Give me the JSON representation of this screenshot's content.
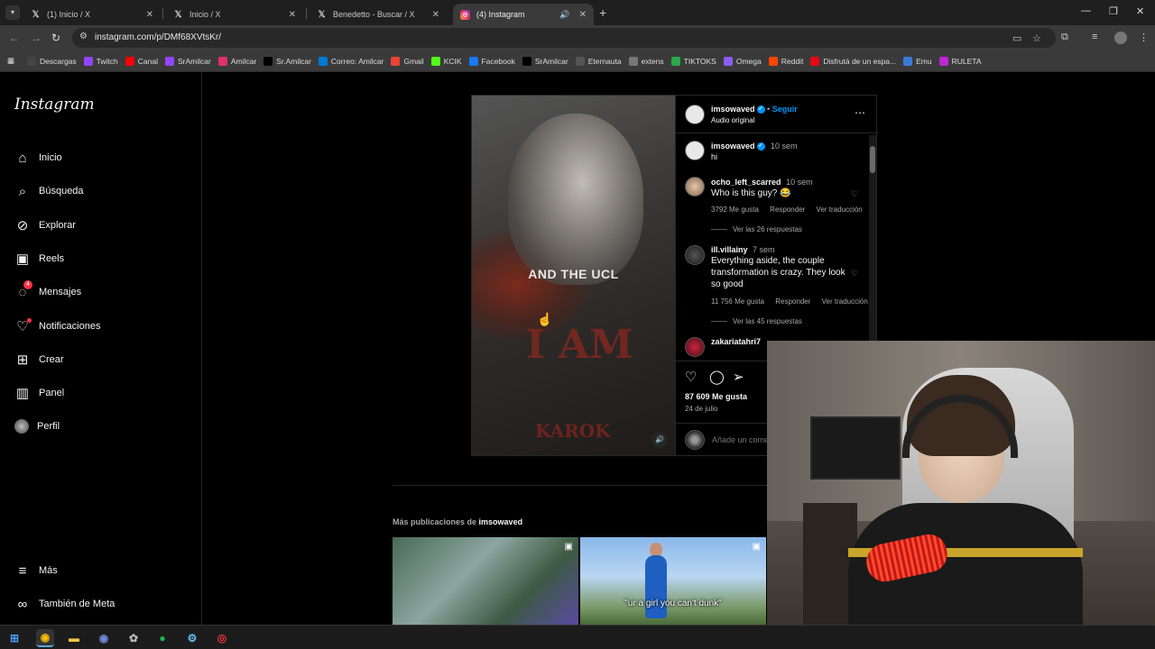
{
  "browser": {
    "tabs": [
      {
        "title": "(1) Inicio / X",
        "icon": "x-logo-icon",
        "active": false
      },
      {
        "title": "Inicio / X",
        "icon": "x-logo-icon",
        "active": false
      },
      {
        "title": "Benedetto - Buscar / X",
        "icon": "x-logo-icon",
        "active": false
      },
      {
        "title": "(4) Instagram",
        "icon": "instagram-icon",
        "active": true
      }
    ],
    "url": "instagram.com/p/DMf68XVtsKr/",
    "bookmarks": [
      {
        "label": "Descargas",
        "color": "#444444"
      },
      {
        "label": "Twitch",
        "color": "#9146ff"
      },
      {
        "label": "Canal",
        "color": "#ff0000"
      },
      {
        "label": "SrAmilcar",
        "color": "#9146ff"
      },
      {
        "label": "Amilcar",
        "color": "#e1306c"
      },
      {
        "label": "Sr.Amilcar",
        "color": "#000000"
      },
      {
        "label": "Correo: Amilcar",
        "color": "#0078d4"
      },
      {
        "label": "Gmail",
        "color": "#ea4335"
      },
      {
        "label": "KCIK",
        "color": "#53fc18"
      },
      {
        "label": "Facebook",
        "color": "#1877f2"
      },
      {
        "label": "SrAmilcar",
        "color": "#000000"
      },
      {
        "label": "Eternauta",
        "color": "#555555"
      },
      {
        "label": "extens",
        "color": "#777777"
      },
      {
        "label": "TIKTOKS",
        "color": "#2aa84a"
      },
      {
        "label": "Omega",
        "color": "#8a5cf6"
      },
      {
        "label": "Reddit",
        "color": "#ff4500"
      },
      {
        "label": "Disfrutá de un espa...",
        "color": "#e50914"
      },
      {
        "label": "Emu",
        "color": "#3a7bd5"
      },
      {
        "label": "RULETA",
        "color": "#c026d3"
      }
    ]
  },
  "instagram": {
    "logo": "Instagram",
    "nav": [
      {
        "label": "Inicio",
        "icon": "home-icon"
      },
      {
        "label": "Búsqueda",
        "icon": "search-icon"
      },
      {
        "label": "Explorar",
        "icon": "compass-icon"
      },
      {
        "label": "Reels",
        "icon": "reels-icon"
      },
      {
        "label": "Mensajes",
        "icon": "messenger-icon",
        "badge": "4"
      },
      {
        "label": "Notificaciones",
        "icon": "heart-icon"
      },
      {
        "label": "Crear",
        "icon": "plus-square-icon"
      },
      {
        "label": "Panel",
        "icon": "chart-icon"
      },
      {
        "label": "Perfil",
        "icon": "avatar-icon"
      }
    ],
    "nav_bottom": [
      {
        "label": "Más",
        "icon": "menu-icon"
      },
      {
        "label": "También de Meta",
        "icon": "meta-icon"
      }
    ],
    "post": {
      "media_caption": "AND THE UCL",
      "media_bg_text": "I AM",
      "media_bg_text2": "KAROK",
      "author": "imsowaved",
      "follow": "Seguir",
      "audio": "Audio original",
      "caption_user": "imsowaved",
      "caption_time": "10 sem",
      "caption_text": "hi",
      "comments": [
        {
          "user": "ocho_left_scarred",
          "time": "10 sem",
          "text": "Who is this guy? 😂",
          "likes": "3792 Me gusta",
          "reply": "Responder",
          "translate": "Ver traducción",
          "replies": "Ver las 26 respuestas"
        },
        {
          "user": "ill.villainy",
          "time": "7 sem",
          "text": "Everything aside, the couple transformation is crazy. They look so good",
          "likes": "11 756 Me gusta",
          "reply": "Responder",
          "translate": "Ver traducción",
          "replies": "Ver las 45 respuestas"
        },
        {
          "user": "zakariatahri7",
          "time": "",
          "text": "",
          "likes": "",
          "reply": "",
          "translate": "",
          "replies": ""
        }
      ],
      "like_count": "87 609 Me gusta",
      "date": "24 de julio",
      "add_comment_placeholder": "Añade un comentario..."
    },
    "more_prefix": "Más publicaciones de",
    "more_user": "imsowaved",
    "thumbnails": [
      {
        "caption": ""
      },
      {
        "caption": "\"ur a girl you can't dunk\""
      }
    ]
  }
}
